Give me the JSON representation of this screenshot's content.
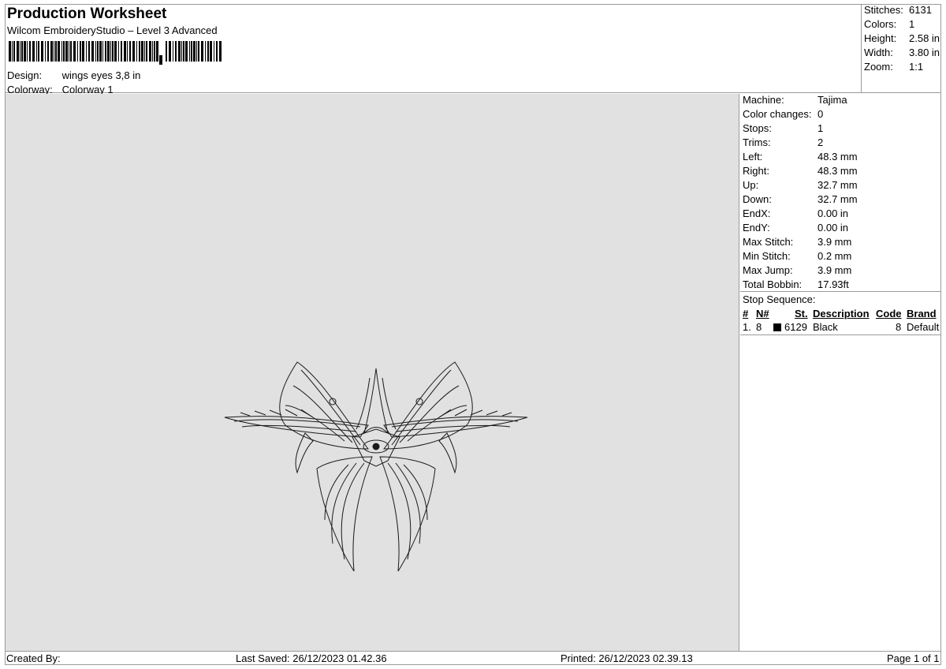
{
  "header": {
    "title": "Production Worksheet",
    "subtitle": "Wilcom EmbroideryStudio – Level 3 Advanced",
    "design_label": "Design:",
    "design_value": "wings eyes 3,8 in",
    "colorway_label": "Colorway:",
    "colorway_value": "Colorway 1"
  },
  "stats_top": [
    {
      "label": "Stitches:",
      "value": "6131"
    },
    {
      "label": "Colors:",
      "value": "1"
    },
    {
      "label": "Height:",
      "value": "2.58 in"
    },
    {
      "label": "Width:",
      "value": "3.80 in"
    },
    {
      "label": "Zoom:",
      "value": "1:1"
    }
  ],
  "machine_info": [
    {
      "label": "Machine:",
      "value": "Tajima"
    },
    {
      "label": "Color changes:",
      "value": "0"
    },
    {
      "label": "Stops:",
      "value": "1"
    },
    {
      "label": "Trims:",
      "value": "2"
    },
    {
      "label": "Left:",
      "value": "48.3 mm"
    },
    {
      "label": "Right:",
      "value": "48.3 mm"
    },
    {
      "label": "Up:",
      "value": "32.7 mm"
    },
    {
      "label": "Down:",
      "value": "32.7 mm"
    },
    {
      "label": "EndX:",
      "value": "0.00 in"
    },
    {
      "label": "EndY:",
      "value": "0.00 in"
    },
    {
      "label": "Max Stitch:",
      "value": "3.9 mm"
    },
    {
      "label": "Min Stitch:",
      "value": "0.2 mm"
    },
    {
      "label": "Max Jump:",
      "value": "3.9 mm"
    },
    {
      "label": "Total Bobbin:",
      "value": "17.93ft"
    }
  ],
  "stop_sequence": {
    "title": "Stop Sequence:",
    "headers": {
      "num": "#",
      "needle": "N#",
      "st": "St.",
      "description": "Description",
      "code": "Code",
      "brand": "Brand"
    },
    "rows": [
      {
        "num": "1.",
        "needle": "8",
        "st": "6129",
        "description": "Black",
        "code": "8",
        "brand": "Default",
        "color": "#000000"
      }
    ]
  },
  "footer": {
    "created_by": "Created By:",
    "last_saved": "Last Saved: 26/12/2023 01.42.36",
    "printed": "Printed: 26/12/2023 02.39.13",
    "page": "Page 1 of 1"
  },
  "colors": {
    "canvas_bg": "#e1e1e1",
    "border": "#9a9a9a",
    "stitch": "#1a1a1a"
  }
}
